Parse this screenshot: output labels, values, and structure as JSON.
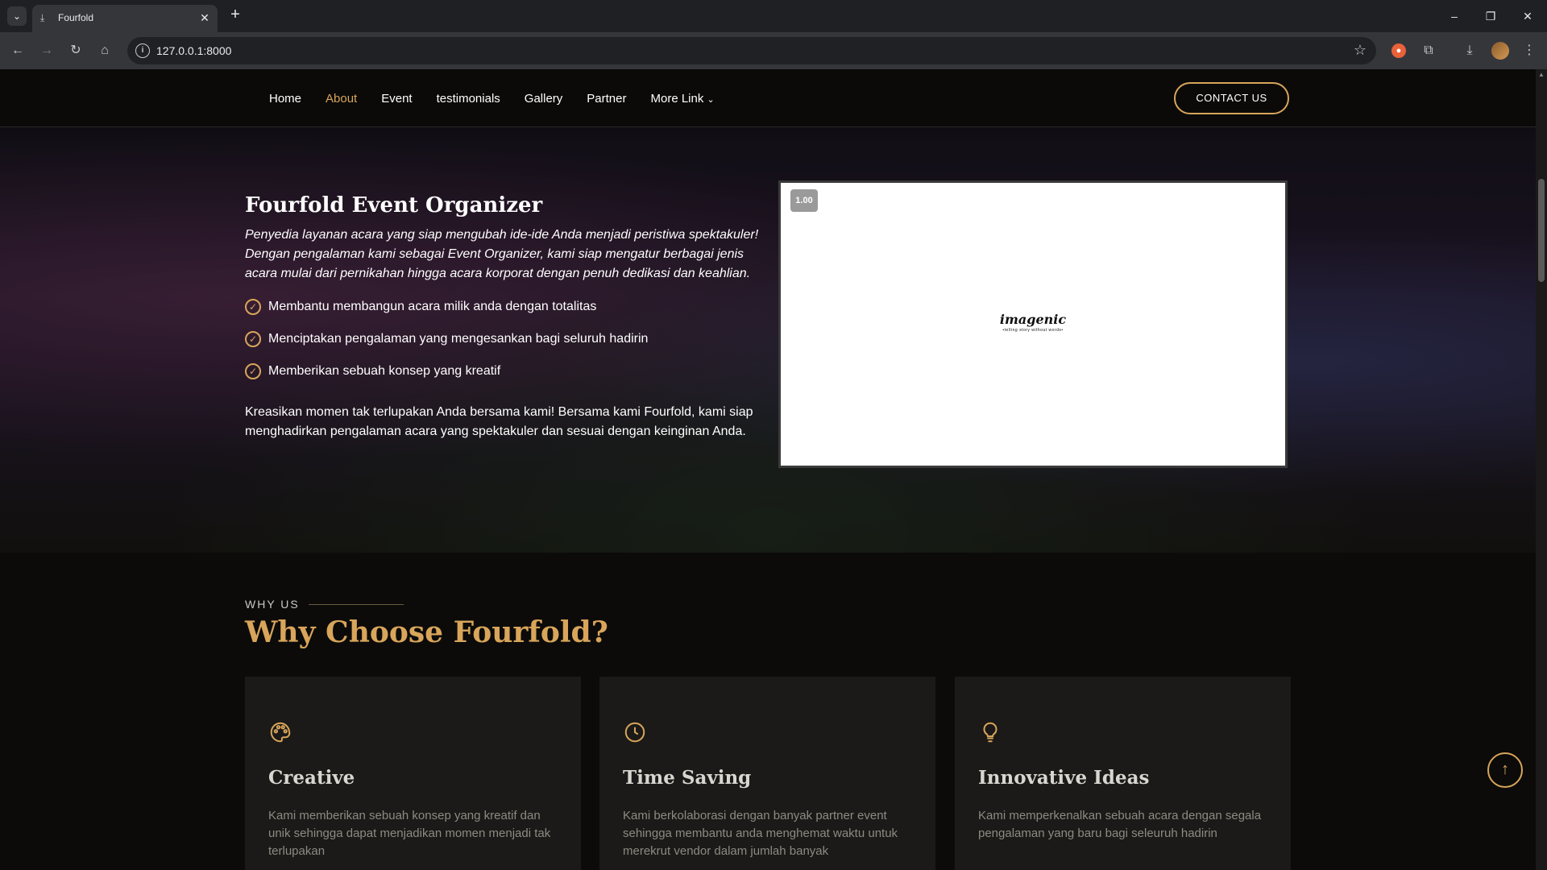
{
  "browser": {
    "tab_title": "Fourfold",
    "url": "127.0.0.1:8000"
  },
  "header": {
    "nav": [
      "Home",
      "About",
      "Event",
      "testimonials",
      "Gallery",
      "Partner",
      "More Link"
    ],
    "active_nav": "About",
    "contact_label": "CONTACT US"
  },
  "hero": {
    "title": "Fourfold Event Organizer",
    "lead": "Penyedia layanan acara yang siap mengubah ide-ide Anda menjadi peristiwa spektakuler! Dengan pengalaman kami sebagai Event Organizer, kami siap mengatur berbagai jenis acara mulai dari pernikahan hingga acara korporat dengan penuh dedikasi dan keahlian.",
    "features": [
      "Membantu membangun acara milik anda dengan totalitas",
      "Menciptakan pengalaman yang mengesankan bagi seluruh hadirin",
      "Memberikan sebuah konsep yang kreatif"
    ],
    "text": "Kreasikan momen tak terlupakan Anda bersama kami! Bersama kami Fourfold, kami siap menghadirkan pengalaman acara yang spektakuler dan sesuai dengan keinginan Anda.",
    "media": {
      "zoom": "1.00",
      "logo_text": "imagenic",
      "logo_tagline": "•telling story without words•"
    }
  },
  "why": {
    "eyebrow": "WHY US",
    "title": "Why Choose Fourfold?",
    "cards": [
      {
        "icon": "palette-icon",
        "title": "Creative",
        "text": "Kami memberikan sebuah konsep yang kreatif dan unik sehingga dapat menjadikan momen menjadi tak terlupakan"
      },
      {
        "icon": "clock-icon",
        "title": "Time Saving",
        "text": "Kami berkolaborasi dengan banyak partner event sehingga membantu anda menghemat waktu untuk merekrut vendor dalam jumlah banyak"
      },
      {
        "icon": "lightbulb-icon",
        "title": "Innovative Ideas",
        "text": "Kami memperkenalkan sebuah acara dengan segala pengalaman yang baru bagi seleuruh hadirin"
      }
    ]
  },
  "colors": {
    "accent": "#d8a55a",
    "background": "#0c0b0a",
    "card": "#1b1a18"
  }
}
